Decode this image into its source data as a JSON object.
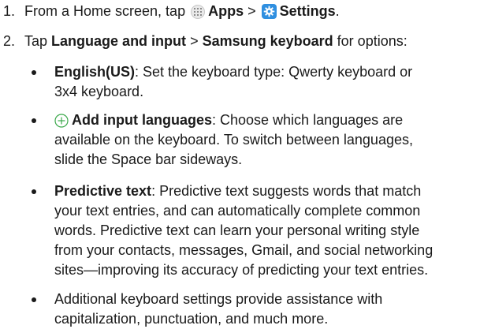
{
  "steps": [
    {
      "number": "1.",
      "prefix": "From a Home screen, tap",
      "apps_label": "Apps",
      "separator": ">",
      "settings_label": "Settings",
      "suffix": "."
    },
    {
      "number": "2.",
      "prefix": "Tap",
      "language_label": "Language and input",
      "separator": ">",
      "keyboard_label": "Samsung keyboard",
      "suffix": "for options:"
    }
  ],
  "bullets": [
    {
      "term": "English(US)",
      "lines": [
        ": Set the keyboard type: Qwerty keyboard or",
        "3x4 keyboard."
      ]
    },
    {
      "term": "Add input languages",
      "lines": [
        ": Choose which languages are",
        "available on the keyboard. To switch between languages,",
        "slide the Space bar sideways."
      ]
    },
    {
      "term": "Predictive text",
      "lines": [
        ": Predictive text suggests words that match",
        "your text entries, and can automatically complete common",
        "words. Predictive text can learn your personal writing style",
        "from your contacts, messages, Gmail, and social networking",
        "sites—improving its accuracy of predicting your text entries."
      ]
    },
    {
      "term": "",
      "lines": [
        "Additional keyboard settings provide assistance with",
        "capitalization, punctuation, and much more."
      ]
    }
  ],
  "icons": {
    "apps": "apps-grid-icon",
    "settings": "settings-gear-icon",
    "add": "plus-circle-icon"
  },
  "colors": {
    "text": "#1a1a1a",
    "settings_icon_bg": "#2f8fe0",
    "plus_icon": "#3aa84a"
  }
}
